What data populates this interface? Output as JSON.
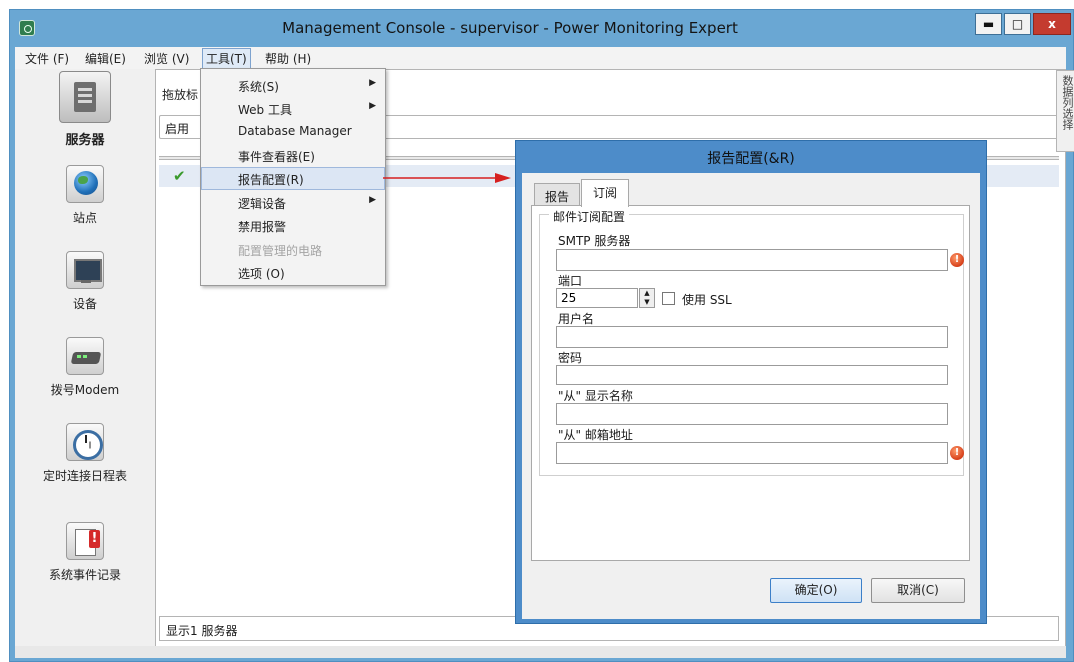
{
  "window": {
    "title": "Management Console - supervisor - Power Monitoring Expert",
    "min_label": "▬",
    "max_label": "□",
    "close_label": "x"
  },
  "menubar": {
    "file": "文件 (F)",
    "edit": "编辑(E)",
    "view": "浏览 (V)",
    "tools": "工具(T)",
    "help": "帮助 (H)"
  },
  "tools_menu": {
    "items": [
      {
        "label": "系统(S)",
        "submenu": true
      },
      {
        "label": "Web 工具",
        "submenu": true
      },
      {
        "label": "Database Manager",
        "submenu": false
      },
      {
        "label": "事件查看器(E)",
        "submenu": false
      },
      {
        "label": "报告配置(R)",
        "submenu": false,
        "highlighted": true
      },
      {
        "label": "逻辑设备",
        "submenu": true
      },
      {
        "label": "禁用报警",
        "submenu": false
      },
      {
        "label": "配置管理的电路",
        "submenu": false,
        "disabled": true
      },
      {
        "label": "选项 (O)",
        "submenu": false
      }
    ],
    "arrow_glyph": "▶"
  },
  "sidebar": {
    "items": [
      {
        "label": "服务器",
        "icon": "server-icon",
        "selected": true
      },
      {
        "label": "站点",
        "icon": "globe-icon"
      },
      {
        "label": "设备",
        "icon": "monitor-icon"
      },
      {
        "label": "拨号Modem",
        "icon": "modem-icon"
      },
      {
        "label": "定时连接日程表",
        "icon": "clock-icon"
      },
      {
        "label": "系统事件记录",
        "icon": "event-log-icon"
      }
    ]
  },
  "content": {
    "drag_hint": "拖放标",
    "filter_text": "启用",
    "row_status_glyph": "✔",
    "status_text": "显示1 服务器",
    "right_tab_label": "数据列选择"
  },
  "dialog": {
    "title": "报告配置(&R)",
    "tabs": [
      "报告",
      "订阅"
    ],
    "active_tab": "订阅",
    "group_title": "邮件订阅配置",
    "fields": {
      "smtp_label": "SMTP 服务器",
      "smtp_value": "",
      "port_label": "端口",
      "port_value": "25",
      "ssl_label": "使用 SSL",
      "ssl_checked": false,
      "username_label": "用户名",
      "username_value": "",
      "password_label": "密码",
      "password_value": "",
      "from_name_label": "\"从\" 显示名称",
      "from_name_value": "",
      "from_email_label": "\"从\" 邮箱地址",
      "from_email_value": ""
    },
    "error_glyph": "!",
    "ok_label": "确定(O)",
    "cancel_label": "取消(C)"
  },
  "colors": {
    "title_bar": "#6aa7d3",
    "dialog_frame": "#4d8cc9",
    "close_button": "#c43b2f",
    "callout_arrow": "#d62020",
    "menu_highlight": "#dce6f4"
  }
}
